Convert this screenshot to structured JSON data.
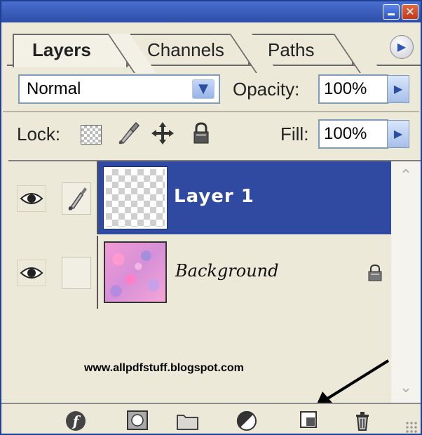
{
  "window": {
    "close_glyph": "✕"
  },
  "tabs": {
    "layers": "Layers",
    "channels": "Channels",
    "paths": "Paths"
  },
  "panel_menu": {
    "glyph": "▶"
  },
  "blend_mode": {
    "value": "Normal",
    "arrow": "▼"
  },
  "opacity": {
    "label": "Opacity:",
    "value": "100%"
  },
  "lock": {
    "label": "Lock:"
  },
  "fill": {
    "label": "Fill:",
    "value": "100%"
  },
  "layers": [
    {
      "name": "Layer 1",
      "selected": true,
      "visible": true,
      "thumbnail": "transparent-checkerboard"
    },
    {
      "name": "Background",
      "selected": false,
      "visible": true,
      "locked": true,
      "thumbnail": "pink-hearts-pattern"
    }
  ],
  "scrollbar": {
    "up": "⌃",
    "down": "⌄"
  },
  "watermark": "www.allpdfstuff.blogspot.com",
  "bottom_toolbar": [
    "add-layer-style-icon",
    "add-mask-icon",
    "new-group-icon",
    "adjustment-layer-icon",
    "new-layer-icon",
    "delete-layer-icon"
  ],
  "colors": {
    "title_bar": "#2c4ea8",
    "selected_row": "#2f4aa0",
    "panel_bg": "#ece9d8",
    "accent_arrow": "#2a4f9f"
  }
}
